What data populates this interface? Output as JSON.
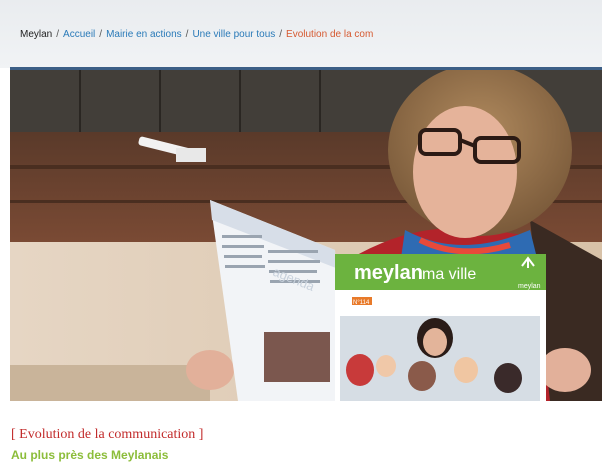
{
  "breadcrumb": {
    "home": "Meylan",
    "separator": "/",
    "items": [
      "Accueil",
      "Mairie en actions",
      "Une ville pour tous"
    ],
    "current": "Evolution de la com"
  },
  "hero": {
    "magazine_title": "meylan",
    "magazine_subtitle": "ma ville",
    "magazine_issue": "N°114",
    "magazine_logo": "meylan",
    "agenda_label": "agenda"
  },
  "article": {
    "heading": "[ Evolution de la communication ]",
    "subheading": "Au plus près des Meylanais"
  },
  "colors": {
    "breadcrumb_link": "#2a7ab8",
    "breadcrumb_current": "#d65a31",
    "heading": "#c22b2b",
    "subheading": "#8cbd3a",
    "rule": "#3d5f86"
  }
}
